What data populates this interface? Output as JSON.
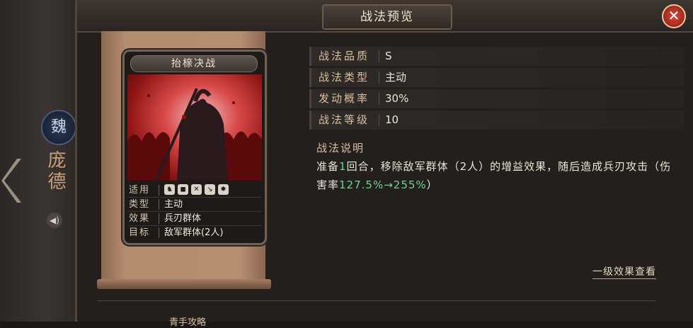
{
  "window": {
    "title": "战法预览",
    "close_icon": "close-icon"
  },
  "sidebar": {
    "faction": "魏",
    "general_name": "庞德"
  },
  "card": {
    "title": "抬榇决战",
    "rows": [
      {
        "key": "适用",
        "icons": [
          "cavalry-icon",
          "shield-icon",
          "bow-icon",
          "spear-icon",
          "chariot-icon"
        ]
      },
      {
        "key": "类型",
        "value": "主动"
      },
      {
        "key": "效果",
        "value": "兵刃群体"
      },
      {
        "key": "目标",
        "value": "敌军群体(2人)"
      }
    ]
  },
  "props": [
    {
      "key": "战法品质",
      "value": "S"
    },
    {
      "key": "战法类型",
      "value": "主动"
    },
    {
      "key": "发动概率",
      "value": "30%"
    },
    {
      "key": "战法等级",
      "value": "10"
    }
  ],
  "description": {
    "title": "战法说明",
    "seg1": "准备",
    "hl1": "1",
    "seg2": "回合，移除敌军群体（2人）的增益效果，随后造成兵刃攻击（伤害率",
    "hl2": "127.5%→255%",
    "seg3": "）"
  },
  "level_link": "一级效果查看",
  "bottom_tip": "青手攻略",
  "colors": {
    "accent": "#d7c09f",
    "highlight": "#6fd38d",
    "close": "#c43a2c"
  }
}
